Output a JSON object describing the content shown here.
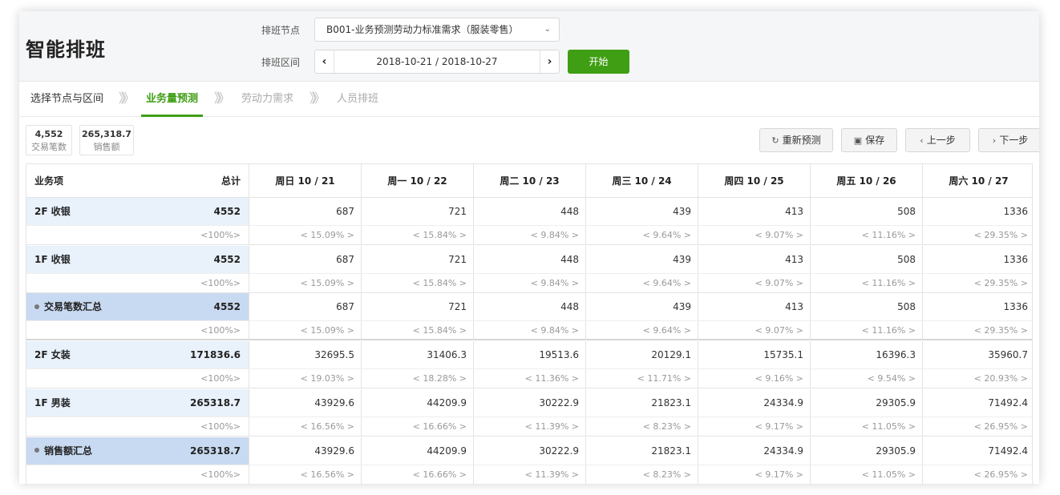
{
  "header": {
    "title": "智能排班",
    "node_label": "排班节点",
    "node_value": "B001-业务预测劳动力标准需求（服装零售）",
    "range_label": "排班区间",
    "range_value": "2018-10-21 / 2018-10-27",
    "start_label": "开始"
  },
  "steps": [
    {
      "label": "选择节点与区间",
      "state": "done"
    },
    {
      "label": "业务量预测",
      "state": "active"
    },
    {
      "label": "劳动力需求",
      "state": "pending"
    },
    {
      "label": "人员排班",
      "state": "pending"
    }
  ],
  "step_separator": "》》",
  "stats": [
    {
      "value": "4,552",
      "caption": "交易笔数"
    },
    {
      "value": "265,318.7",
      "caption": "销售额"
    }
  ],
  "toolbar": {
    "reforecast": "重新预测",
    "save": "保存",
    "prev": "上一步",
    "next": "下一步"
  },
  "table": {
    "col_item": "业务项",
    "col_total": "总计",
    "days": [
      "周日 10 / 21",
      "周一 10 / 22",
      "周二 10 / 23",
      "周三 10 / 24",
      "周四 10 / 25",
      "周五 10 / 26",
      "周六 10 / 27"
    ],
    "rows": [
      {
        "name": "2F 收银",
        "total": "4552",
        "total_pct": "<100%>",
        "summary": false,
        "values": [
          "687",
          "721",
          "448",
          "439",
          "413",
          "508",
          "1336"
        ],
        "pcts": [
          "< 15.09% >",
          "< 15.84% >",
          "< 9.84% >",
          "< 9.64% >",
          "< 9.07% >",
          "< 11.16% >",
          "< 29.35% >"
        ]
      },
      {
        "name": "1F 收银",
        "total": "4552",
        "total_pct": "<100%>",
        "summary": false,
        "values": [
          "687",
          "721",
          "448",
          "439",
          "413",
          "508",
          "1336"
        ],
        "pcts": [
          "< 15.09% >",
          "< 15.84% >",
          "< 9.84% >",
          "< 9.64% >",
          "< 9.07% >",
          "< 11.16% >",
          "< 29.35% >"
        ]
      },
      {
        "name": "交易笔数汇总",
        "total": "4552",
        "total_pct": "<100%>",
        "summary": true,
        "values": [
          "687",
          "721",
          "448",
          "439",
          "413",
          "508",
          "1336"
        ],
        "pcts": [
          "< 15.09% >",
          "< 15.84% >",
          "< 9.84% >",
          "< 9.64% >",
          "< 9.07% >",
          "< 11.16% >",
          "< 29.35% >"
        ]
      },
      {
        "name": "2F 女装",
        "total": "171836.6",
        "total_pct": "<100%>",
        "summary": false,
        "values": [
          "32695.5",
          "31406.3",
          "19513.6",
          "20129.1",
          "15735.1",
          "16396.3",
          "35960.7"
        ],
        "pcts": [
          "< 19.03% >",
          "< 18.28% >",
          "< 11.36% >",
          "< 11.71% >",
          "< 9.16% >",
          "< 9.54% >",
          "< 20.93% >"
        ]
      },
      {
        "name": "1F 男装",
        "total": "265318.7",
        "total_pct": "<100%>",
        "summary": false,
        "values": [
          "43929.6",
          "44209.9",
          "30222.9",
          "21823.1",
          "24334.9",
          "29305.9",
          "71492.4"
        ],
        "pcts": [
          "< 16.56% >",
          "< 16.66% >",
          "< 11.39% >",
          "< 8.23% >",
          "< 9.17% >",
          "< 11.05% >",
          "< 26.95% >"
        ]
      },
      {
        "name": "销售额汇总",
        "total": "265318.7",
        "total_pct": "<100%>",
        "summary": true,
        "values": [
          "43929.6",
          "44209.9",
          "30222.9",
          "21823.1",
          "24334.9",
          "29305.9",
          "71492.4"
        ],
        "pcts": [
          "< 16.56% >",
          "< 16.66% >",
          "< 11.39% >",
          "< 8.23% >",
          "< 9.17% >",
          "< 11.05% >",
          "< 26.95% >"
        ]
      }
    ]
  },
  "colors": {
    "accent": "#3f9e14",
    "row_highlight": "#e9f1fb",
    "summary_highlight": "#c8daf1"
  }
}
